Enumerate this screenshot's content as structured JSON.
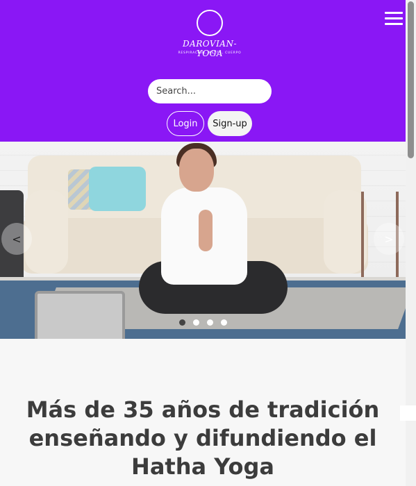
{
  "header": {
    "logo": {
      "name": "DAROVIAN-YOGA",
      "tagline": "RESPIRACIÓN, MENTE, CUERPO"
    },
    "menu_icon": "hamburger-menu-icon",
    "search": {
      "placeholder": "Search...",
      "value": ""
    },
    "login_label": "Login",
    "signup_label": "Sign-up",
    "background_color": "#8a17f5"
  },
  "carousel": {
    "image": "woman-meditating-on-yoga-mat",
    "prev_label": "<",
    "next_label": ">",
    "slide_count": 4,
    "active_slide": 1
  },
  "main": {
    "heading": "Más de 35 años de tradición enseñando y difundiendo el Hatha Yoga"
  }
}
